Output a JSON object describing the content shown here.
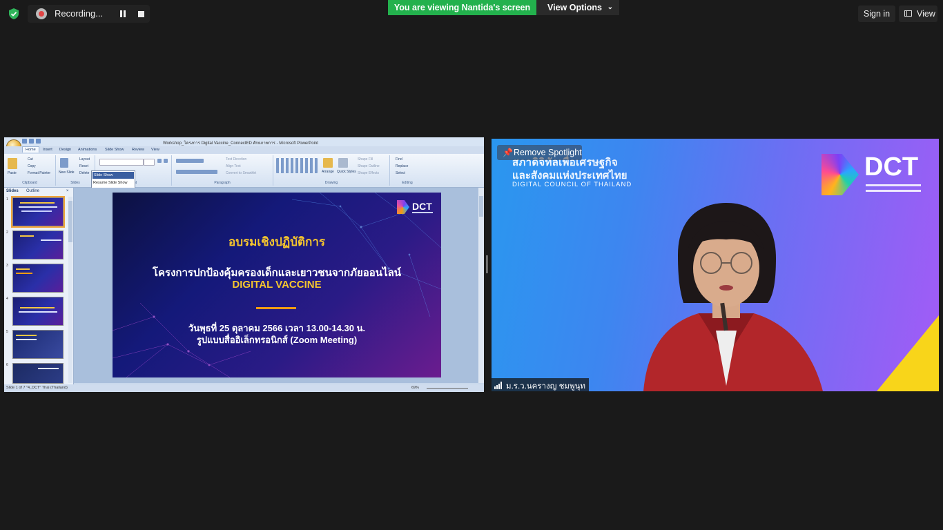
{
  "topbar": {
    "recording_label": "Recording...",
    "viewing_banner": "You are viewing Nantida's screen",
    "view_options_label": "View Options",
    "signin_label": "Sign in",
    "view_label": "View",
    "colors": {
      "banner_green": "#23b14d",
      "record_red": "#e04343"
    }
  },
  "ppt": {
    "window_title": "Workshop_โครงการ Digital Vaccine_ConnectED ศักยภาพการ - Microsoft PowerPoint",
    "tabs": [
      "Home",
      "Insert",
      "Design",
      "Animations",
      "Slide Show",
      "Review",
      "View"
    ],
    "groups": {
      "clipboard": {
        "label": "Clipboard",
        "paste": "Paste",
        "cut": "Cut",
        "copy": "Copy",
        "format_painter": "Format Painter"
      },
      "slides": {
        "label": "Slides",
        "new_slide": "New Slide",
        "layout": "Layout",
        "reset": "Reset",
        "delete": "Delete"
      },
      "font": {
        "label": "Font"
      },
      "paragraph": {
        "label": "Paragraph",
        "text_direction": "Text Direction",
        "align_text": "Align Text",
        "convert": "Convert to SmartArt"
      },
      "drawing": {
        "label": "Drawing",
        "arrange": "Arrange",
        "quick_styles": "Quick Styles",
        "shape_fill": "Shape Fill",
        "shape_outline": "Shape Outline",
        "shape_effects": "Shape Effects"
      },
      "editing": {
        "label": "Editing",
        "find": "Find",
        "replace": "Replace",
        "select": "Select"
      }
    },
    "slideshow_dropdown": {
      "selected": "Slide Show",
      "item": "Resume Slide Show"
    },
    "pane_tabs": {
      "slides": "Slides",
      "outline": "Outline"
    },
    "thumb_numbers": [
      "1",
      "2",
      "3",
      "4",
      "5",
      "6"
    ],
    "status": {
      "left": "Slide 1 of 7   \"4_DCT\"   Thai (Thailand)",
      "zoom": "69%"
    },
    "slide": {
      "logo": "DCT",
      "title": "อบรมเชิงปฏิบัติการ",
      "subtitle": "โครงการปกป้องคุ้มครองเด็กและเยาวชนจากภัยออนไลน์",
      "highlight": "DIGITAL VACCINE",
      "date_line": "วันพุธที่ 25 ตุลาคม 2566  เวลา 13.00-14.30 น.",
      "format_line": "รูปแบบสื่ออิเล็กทรอนิกส์ (Zoom Meeting)",
      "colors": {
        "gold": "#f6c62d",
        "bar": "#f39c12"
      }
    }
  },
  "video": {
    "spotlight_label": "Remove Spotlight",
    "org_line1": "สภาดิจิทัลเพื่อเศรษฐกิจ",
    "org_line2": "และสังคมแห่งประเทศไทย",
    "org_line3": "DIGITAL COUNCIL OF THAILAND",
    "dct_logo": "DCT",
    "participant_name": "ม.ร.ว.นครางญ ชมพูนุท",
    "colors": {
      "bg_left": "#2a97ef",
      "bg_right": "#a35bf6",
      "accent_yellow": "#f8d51a"
    }
  }
}
